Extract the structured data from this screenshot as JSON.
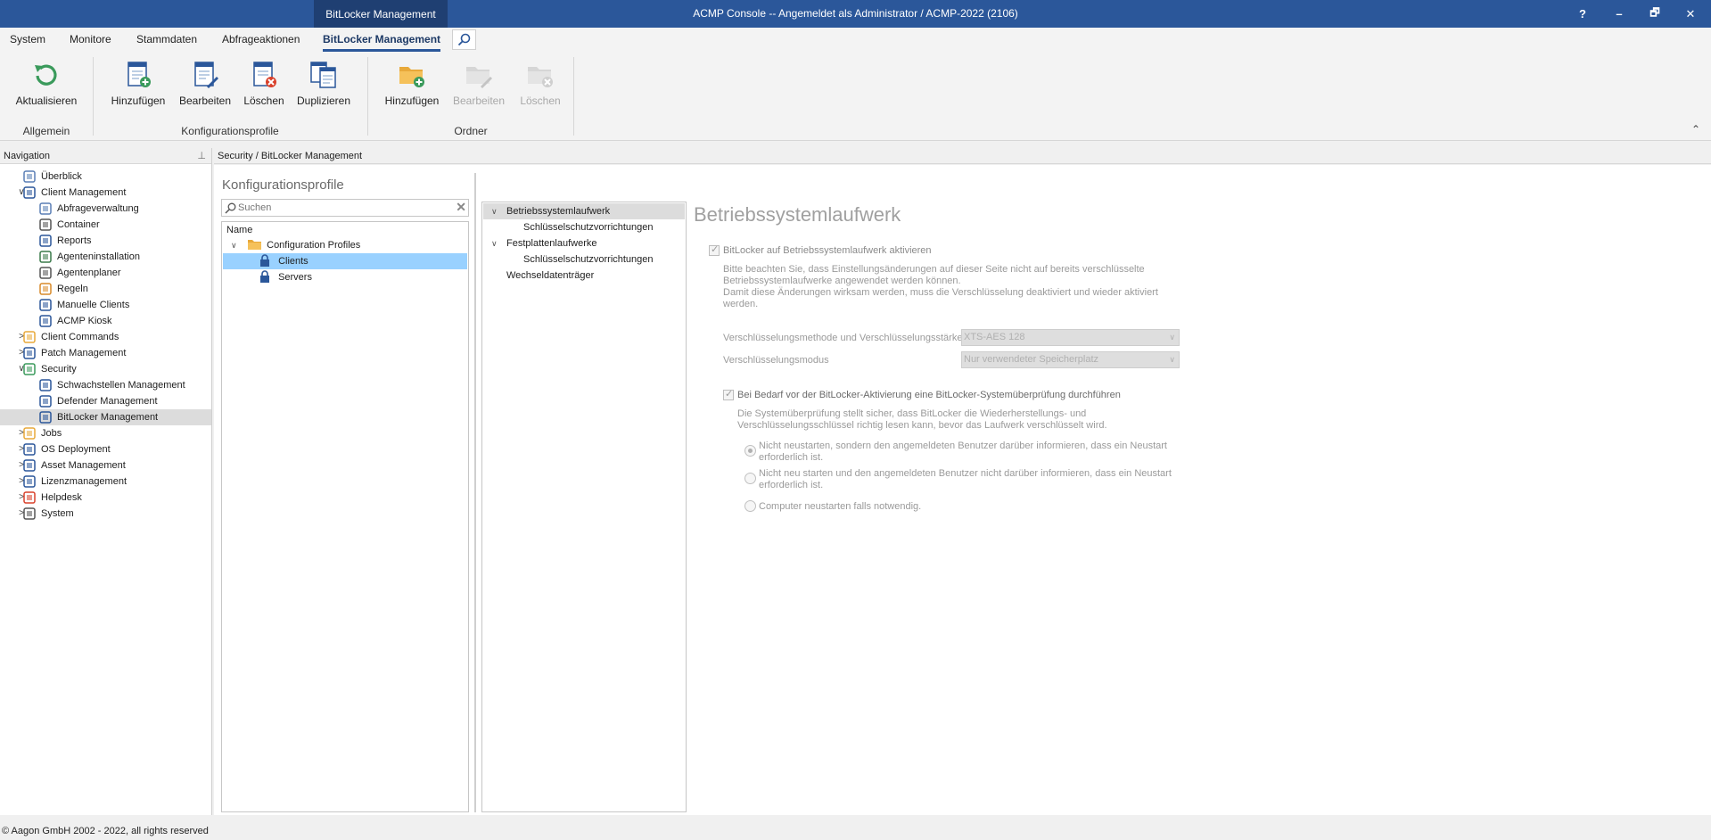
{
  "window": {
    "context_tab": "BitLocker Management",
    "title": "ACMP Console -- Angemeldet als Administrator / ACMP-2022 (2106)",
    "help": "?",
    "minimize": "–",
    "restore": "🗗",
    "close": "✕"
  },
  "menu": {
    "tabs": [
      "System",
      "Monitore",
      "Stammdaten",
      "Abfrageaktionen",
      "BitLocker Management"
    ],
    "active_tab": "BitLocker Management"
  },
  "ribbon": {
    "refresh": "Aktualisieren",
    "group_allgemein": "Allgemein",
    "profile_add": "Hinzufügen",
    "profile_edit": "Bearbeiten",
    "profile_delete": "Löschen",
    "profile_duplicate": "Duplizieren",
    "group_profiles": "Konfigurationsprofile",
    "folder_add": "Hinzufügen",
    "folder_edit": "Bearbeiten",
    "folder_delete": "Löschen",
    "group_folder": "Ordner",
    "collapse": "⌃"
  },
  "navigation": {
    "header": "Navigation",
    "pin": "📌",
    "items": [
      {
        "label": "Überblick",
        "icon": "overview-icon"
      },
      {
        "label": "Client Management",
        "icon": "monitor-icon"
      },
      {
        "label": "Abfrageverwaltung",
        "icon": "query-icon"
      },
      {
        "label": "Container",
        "icon": "container-icon"
      },
      {
        "label": "Reports",
        "icon": "reports-icon"
      },
      {
        "label": "Agenteninstallation",
        "icon": "agent-install-icon"
      },
      {
        "label": "Agentenplaner",
        "icon": "clock-icon"
      },
      {
        "label": "Regeln",
        "icon": "rules-icon"
      },
      {
        "label": "Manuelle Clients",
        "icon": "manual-clients-icon"
      },
      {
        "label": "ACMP Kiosk",
        "icon": "kiosk-icon"
      },
      {
        "label": "Client Commands",
        "icon": "puzzle-icon"
      },
      {
        "label": "Patch Management",
        "icon": "patch-icon"
      },
      {
        "label": "Security",
        "icon": "shield-check-icon"
      },
      {
        "label": "Schwachstellen Management",
        "icon": "shield-icon"
      },
      {
        "label": "Defender Management",
        "icon": "defender-icon"
      },
      {
        "label": "BitLocker Management",
        "icon": "lock-icon"
      },
      {
        "label": "Jobs",
        "icon": "jobs-icon"
      },
      {
        "label": "OS Deployment",
        "icon": "os-deploy-icon"
      },
      {
        "label": "Asset Management",
        "icon": "asset-icon"
      },
      {
        "label": "Lizenzmanagement",
        "icon": "license-icon"
      },
      {
        "label": "Helpdesk",
        "icon": "helpdesk-icon"
      },
      {
        "label": "System",
        "icon": "system-icon"
      }
    ],
    "selected": "BitLocker Management"
  },
  "breadcrumb": "Security / BitLocker Management",
  "profiles": {
    "title": "Konfigurationsprofile",
    "search_placeholder": "Suchen",
    "column_name": "Name",
    "root": "Configuration Profiles",
    "children": [
      "Clients",
      "Servers"
    ],
    "selected": "Clients"
  },
  "settings_tree": {
    "items": [
      {
        "label": "Betriebssystemlaufwerk",
        "level": 0,
        "expanded": true
      },
      {
        "label": "Schlüsselschutzvorrichtungen",
        "level": 1
      },
      {
        "label": "Festplattenlaufwerke",
        "level": 0,
        "expanded": true
      },
      {
        "label": "Schlüsselschutzvorrichtungen",
        "level": 1
      },
      {
        "label": "Wechseldatenträger",
        "level": 0
      }
    ],
    "selected": "Betriebssystemlaufwerk"
  },
  "detail": {
    "title": "Betriebssystemlaufwerk",
    "enable_label": "BitLocker auf Betriebssystemlaufwerk aktivieren",
    "enable_checked": true,
    "note_line1": "Bitte beachten Sie, dass Einstellungsänderungen auf dieser Seite nicht auf bereits verschlüsselte",
    "note_line2": "Betriebssystemlaufwerke angewendet werden können.",
    "note_line3": "Damit diese Änderungen wirksam werden, muss die Verschlüsselung deaktiviert und wieder aktiviert",
    "note_line4": "werden.",
    "method_label": "Verschlüsselungsmethode und Verschlüsselungsstärke",
    "method_value": "XTS-AES 128",
    "mode_label": "Verschlüsselungsmodus",
    "mode_value": "Nur verwendeter Speicherplatz",
    "check_label": "Bei Bedarf vor der BitLocker-Aktivierung eine BitLocker-Systemüberprüfung durchführen",
    "check_checked": true,
    "check_desc1": "Die Systemüberprüfung stellt sicher, dass BitLocker die Wiederherstellungs- und",
    "check_desc2": "Verschlüsselungsschlüssel richtig lesen kann, bevor das Laufwerk verschlüsselt wird.",
    "radio1_line1": "Nicht neustarten, sondern den angemeldeten Benutzer darüber informieren, dass ein Neustart",
    "radio1_line2": "erforderlich ist.",
    "radio2_line1": "Nicht neu starten und den angemeldeten Benutzer nicht darüber informieren, dass ein Neustart",
    "radio2_line2": "erforderlich ist.",
    "radio3": "Computer neustarten falls notwendig.",
    "radio_selected": 1
  },
  "status": "© Aagon GmbH 2002 - 2022, all rights reserved"
}
